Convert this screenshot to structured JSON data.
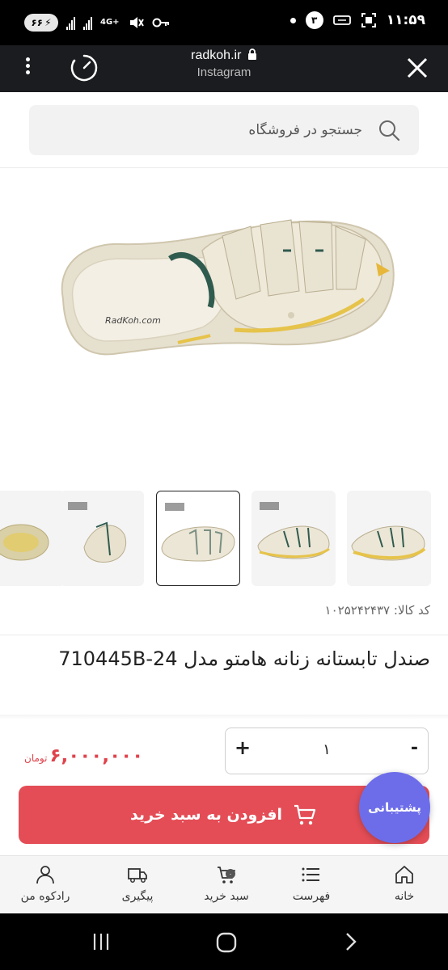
{
  "status_bar": {
    "time": "۱۱:۵۹",
    "battery_level": "۶۶",
    "network": "4G+",
    "notification_count": "۳"
  },
  "browser": {
    "url": "radkoh.ir",
    "source": "Instagram"
  },
  "search": {
    "placeholder": "جستجو در فروشگاه"
  },
  "product": {
    "code_label": "کد کالا:",
    "code_value": "۱۰۲۵۲۴۲۴۳۷",
    "title": "صندل تابستانه زنانه هامتو مدل 710445B-24",
    "price_value": "۶,۰۰۰,۰۰۰",
    "price_unit": "تومان",
    "quantity": "۱",
    "qty_plus": "+",
    "qty_minus": "-",
    "watermark": "RadKoh.com",
    "thumbnail_count": 5,
    "selected_thumbnail": 3
  },
  "actions": {
    "add_to_cart": "افزودن به سبد خرید",
    "support": "پشتیبانی"
  },
  "bottom_nav": {
    "items": [
      {
        "label": "خانه",
        "icon": "home-icon"
      },
      {
        "label": "فهرست",
        "icon": "list-icon"
      },
      {
        "label": "سبد خرید",
        "icon": "cart-icon",
        "badge": "۰"
      },
      {
        "label": "پیگیری",
        "icon": "truck-icon"
      },
      {
        "label": "رادکوه من",
        "icon": "user-icon"
      }
    ]
  },
  "colors": {
    "accent": "#e44d56",
    "support": "#6d6dea",
    "price": "#e0424b"
  }
}
